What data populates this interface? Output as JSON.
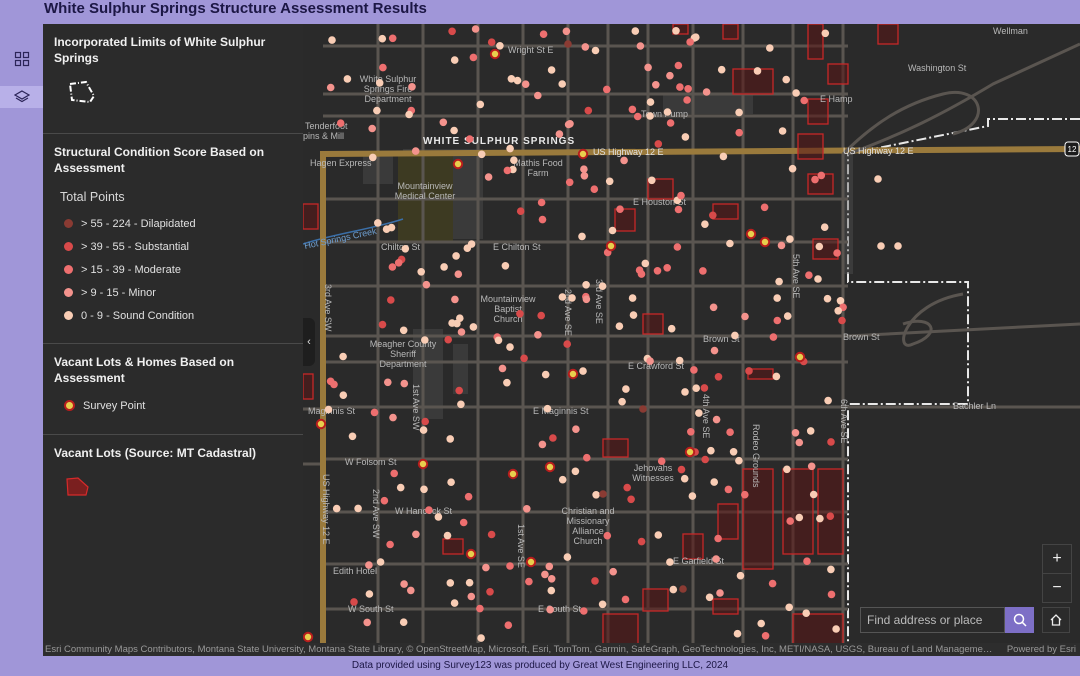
{
  "app": {
    "title": "White Sulphur Springs Structure Assessment Results"
  },
  "rail": {
    "legend_icon": "grid-icon",
    "layers_icon": "layers-icon"
  },
  "legend": {
    "limits_title": "Incorporated Limits of White Sulphur Springs",
    "condition_title": "Structural Condition Score Based on Assessment",
    "condition_subtitle": "Total Points",
    "condition_items": [
      {
        "label": "> 55 - 224 - Dilapidated",
        "color": "#8a3b33"
      },
      {
        "label": "> 39 - 55 - Substantial",
        "color": "#d84a4a"
      },
      {
        "label": "> 15 - 39 - Moderate",
        "color": "#ee6f6f"
      },
      {
        "label": "> 9 - 15 - Minor",
        "color": "#f4938d"
      },
      {
        "label": "0 - 9 - Sound Condition",
        "color": "#f9cdb5"
      }
    ],
    "vacant_title": "Vacant Lots & Homes Based on Assessment",
    "survey_point_label": "Survey Point",
    "cadastral_title": "Vacant Lots (Source: MT Cadastral)"
  },
  "map": {
    "labels": {
      "town": "WHITE SULPHUR SPRINGS",
      "highway_12": "US Highway 12 E",
      "highway_shield": "12",
      "fire_dept": "White Sulphur Springs Fire Department",
      "town_pump": "Town Pump",
      "mathis": "Mathis Food Farm",
      "medical": "Mountainview Medical Center",
      "hot_springs_creek": "Hot Springs Creek",
      "sheriff": "Meagher County Sheriff Department",
      "baptist": "Mountainview Baptist Church",
      "jehovahs": "Jehovahs Witnesses",
      "christian": "Christian and Missionary Alliance Church",
      "edith": "Edith Hotel",
      "hagen": "Hagen Express",
      "tenderfoot": "Tenderfoot",
      "tenderfoot2": "pins & Mill",
      "rodeo": "Rodeo Grounds"
    },
    "streets": {
      "wright": "Wright St E",
      "washington": "Washington St",
      "hampton": "E Hamp",
      "houston": "E Houston St",
      "chilton_w": "Chilton St",
      "chilton_e": "E Chilton St",
      "brown": "Brown St",
      "brown_e": "Brown St",
      "crawford": "E Crawford St",
      "maginnis_w": "Maginnis St",
      "maginnis_e": "E Maginnis St",
      "folsom": "W Folsom St",
      "hancock": "W Hancock St",
      "garfield": "E Garfield St",
      "south_w": "W South St",
      "south_e": "E South St",
      "bachler": "Bachler Ln",
      "wellman": "Wellman",
      "ave3_sw": "3rd Ave SW",
      "ave1_sw": "1st Ave SW",
      "ave2_sw": "2nd Ave SW",
      "ave1_se": "1st Ave SE",
      "ave2_se": "2nd Ave SE",
      "ave3_se": "3rd Ave SE",
      "ave4_se": "4th Ave SE",
      "ave5_se": "5th Ave SE",
      "ave6_se": "6th Ave SE",
      "hwy12_s": "US Highway 12 E"
    },
    "colors": {
      "dilapidated": "#8a3b33",
      "substantial": "#d84a4a",
      "moderate": "#ee6f6f",
      "minor": "#f4938d",
      "sound": "#f9cdb5",
      "survey_fill": "#e8cf4d",
      "survey_ring": "#b81d1d",
      "highway": "#9a7a3c",
      "vacant_outline": "#c62828"
    }
  },
  "controls": {
    "zoom_in": "+",
    "zoom_out": "−",
    "search_placeholder": "Find address or place"
  },
  "attribution": {
    "text": "Esri Community Maps Contributors, Montana State University, Montana State Library, © OpenStreetMap, Microsoft, Esri, TomTom, Garmin, SafeGraph, GeoTechnologies, Inc, METI/NASA, USGS, Bureau of Land Management, EPA, NPS, US Census Bureau, USDA, USFWS",
    "powered": "Powered by Esri"
  },
  "footer": {
    "text": "Data provided using Survey123 was produced by Great West Engineering LLC, 2024"
  }
}
